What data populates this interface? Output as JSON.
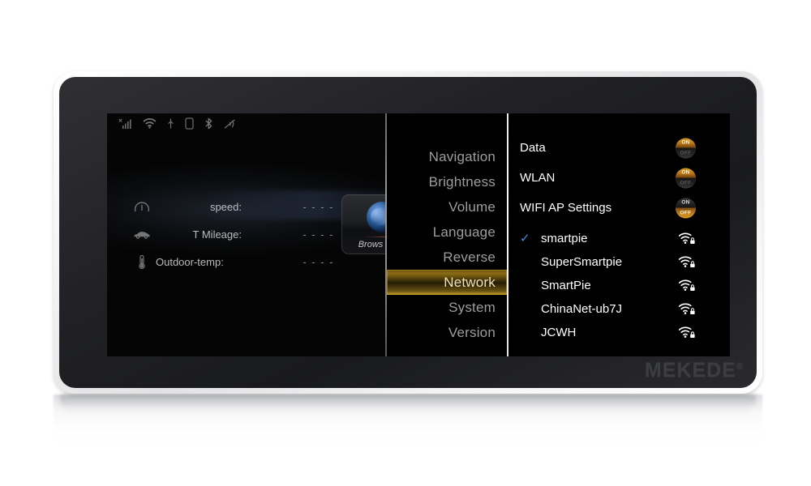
{
  "device": {
    "brand": "MEKEDE",
    "brand_mark": "®",
    "frame_color": "#f1f1f2",
    "bezel_color": "#232327"
  },
  "screen": {
    "background": "#000000",
    "statusbar": {
      "icons": [
        {
          "name": "signal-bars-no-service-icon",
          "label": "signal"
        },
        {
          "name": "wifi-icon",
          "label": "wifi"
        },
        {
          "name": "usb-icon",
          "label": "usb"
        },
        {
          "name": "sim-card-icon",
          "label": "sim"
        },
        {
          "name": "bluetooth-icon",
          "label": "bluetooth"
        },
        {
          "name": "mute-icon",
          "label": "mute"
        }
      ]
    },
    "left_panel": {
      "info_rows": [
        {
          "icon": "speedometer-icon",
          "label": "speed:",
          "value": "- - - -"
        },
        {
          "icon": "car-icon",
          "label": "T Mileage:",
          "value": "- - - -"
        },
        {
          "icon": "thermometer-icon",
          "label": "Outdoor-temp:",
          "value": "- - - -"
        }
      ],
      "tile": {
        "icon": "globe-icon",
        "label": "Brows"
      }
    },
    "menu": {
      "items": [
        {
          "label": "Navigation",
          "active": false
        },
        {
          "label": "Brightness",
          "active": false
        },
        {
          "label": "Volume",
          "active": false
        },
        {
          "label": "Language",
          "active": false
        },
        {
          "label": "Reverse",
          "active": false
        },
        {
          "label": "Network",
          "active": true
        },
        {
          "label": "System",
          "active": false
        },
        {
          "label": "Version",
          "active": false
        }
      ],
      "active_highlight_color": "#8a6b16",
      "active_text_color": "#f3e3b3"
    },
    "settings": {
      "rows": [
        {
          "label": "Data",
          "toggle_on_label": "ON",
          "toggle_off_label": "OFF",
          "state": "on"
        },
        {
          "label": "WLAN",
          "toggle_on_label": "ON",
          "toggle_off_label": "OFF",
          "state": "on"
        },
        {
          "label": "WIFI AP Settings",
          "toggle_on_label": "ON",
          "toggle_off_label": "OFF",
          "state": "off"
        }
      ],
      "toggle_accent_color": "#c98a1e"
    },
    "wifi_networks": [
      {
        "name": "smartpie",
        "connected": true,
        "secured": true,
        "signal": 3
      },
      {
        "name": "SuperSmartpie",
        "connected": false,
        "secured": true,
        "signal": 3
      },
      {
        "name": "SmartPie",
        "connected": false,
        "secured": true,
        "signal": 3
      },
      {
        "name": "ChinaNet-ub7J",
        "connected": false,
        "secured": true,
        "signal": 3
      },
      {
        "name": "JCWH",
        "connected": false,
        "secured": true,
        "signal": 3
      }
    ],
    "check_color": "#3d8fdd"
  }
}
